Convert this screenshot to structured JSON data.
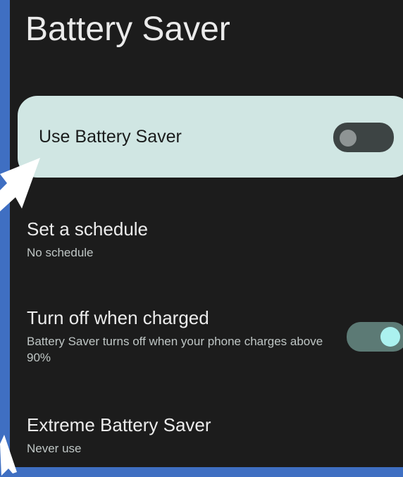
{
  "page_title": "Battery Saver",
  "main_toggle": {
    "label": "Use Battery Saver",
    "state": "off"
  },
  "settings": [
    {
      "title": "Set a schedule",
      "subtitle": "No schedule"
    },
    {
      "title": "Turn off when charged",
      "subtitle": "Battery Saver turns off when your phone charges above 90%",
      "toggle_state": "on"
    },
    {
      "title": "Extreme Battery Saver",
      "subtitle": "Never use"
    }
  ],
  "colors": {
    "background_frame": "#3f6fc2",
    "screen": "#1c1c1c",
    "card": "#d0e6e3",
    "toggle_on_thumb": "#abf1ef",
    "annotation_arrow": "#ffffff"
  },
  "icons": [
    "annotation-arrow-icon"
  ]
}
